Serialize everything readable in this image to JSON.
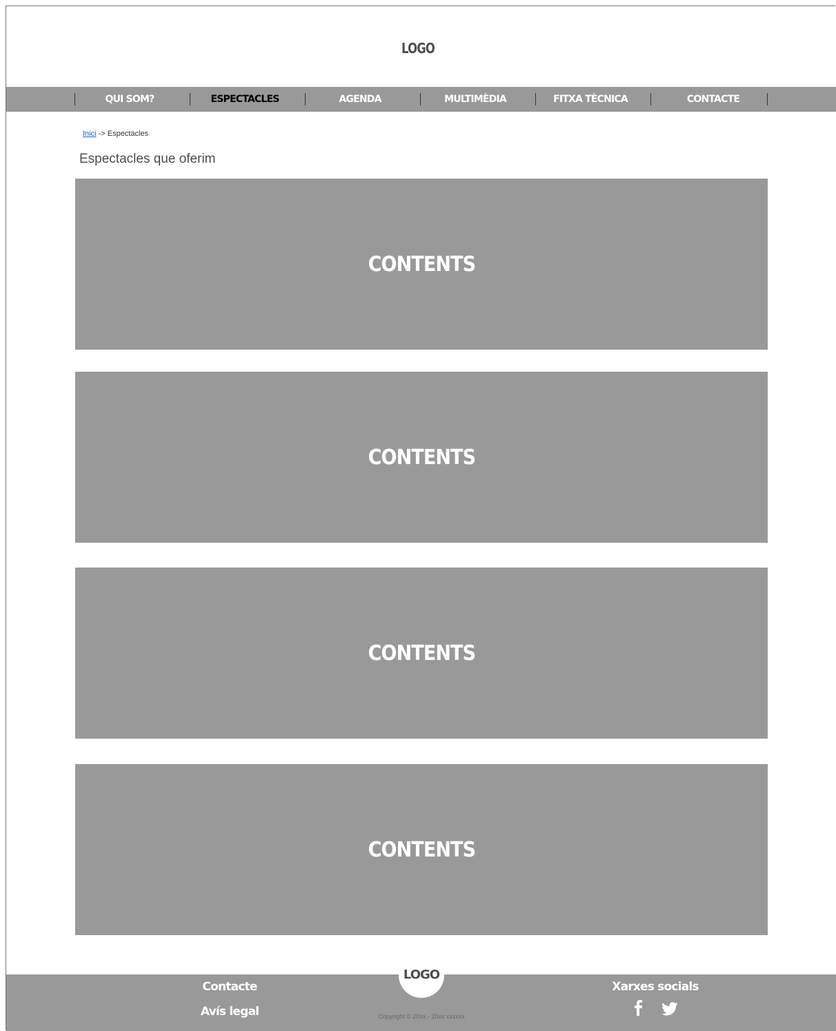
{
  "header": {
    "logo": "LOGO"
  },
  "nav": {
    "items": [
      {
        "label": "QUI SOM?"
      },
      {
        "label": "ESPECTACLES"
      },
      {
        "label": "AGENDA"
      },
      {
        "label": "MULTIMÈDIA"
      },
      {
        "label": "FITXA TÈCNICA"
      },
      {
        "label": "CONTACTE"
      }
    ],
    "active": "ESPECTACLES"
  },
  "breadcrumb": {
    "home": "Inici",
    "separator": "->",
    "current": "Espectacles"
  },
  "main": {
    "title": "Espectacles que oferim",
    "blocks": [
      {
        "label": "CONTENTS"
      },
      {
        "label": "CONTENTS"
      },
      {
        "label": "CONTENTS"
      },
      {
        "label": "CONTENTS"
      }
    ]
  },
  "footer": {
    "contact": "Contacte",
    "legal": "Avís legal",
    "logo": "LOGO",
    "copyright": "Copyright © 20xx - 20xx xxxxxx",
    "social_title": "Xarxes socials",
    "social_icons": [
      "facebook-icon",
      "twitter-icon"
    ]
  },
  "colors": {
    "bar": "#999999",
    "link": "#1a5fd0",
    "active_nav": "#000000"
  }
}
